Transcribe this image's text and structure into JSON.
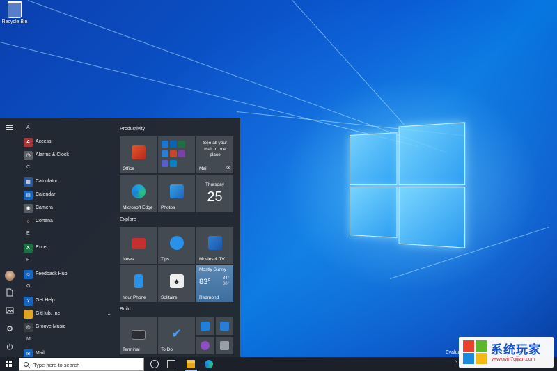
{
  "desktop": {
    "recycle_bin_label": "Recycle Bin",
    "evaluation_text": "Evalua"
  },
  "start_menu": {
    "rail_icons": [
      "hamburger-icon",
      "avatar",
      "document-icon",
      "pictures-icon",
      "gear-icon",
      "power-icon"
    ],
    "app_list": [
      {
        "type": "letter",
        "text": "A"
      },
      {
        "type": "app",
        "name": "Access",
        "icon": "access-icon",
        "color": "#a4373a",
        "glyph": "A"
      },
      {
        "type": "app",
        "name": "Alarms & Clock",
        "icon": "alarm-clock-icon",
        "color": "#5b5f66",
        "glyph": "◷"
      },
      {
        "type": "letter",
        "text": "C"
      },
      {
        "type": "app",
        "name": "Calculator",
        "icon": "calculator-icon",
        "color": "#2b5797",
        "glyph": "▦"
      },
      {
        "type": "app",
        "name": "Calendar",
        "icon": "calendar-icon",
        "color": "#1565c0",
        "glyph": "▤"
      },
      {
        "type": "app",
        "name": "Camera",
        "icon": "camera-icon",
        "color": "#555a60",
        "glyph": "◉"
      },
      {
        "type": "app",
        "name": "Cortana",
        "icon": "cortana-icon",
        "color": "#24282e",
        "glyph": "○"
      },
      {
        "type": "letter",
        "text": "E"
      },
      {
        "type": "app",
        "name": "Excel",
        "icon": "excel-icon",
        "color": "#1d7044",
        "glyph": "X"
      },
      {
        "type": "letter",
        "text": "F"
      },
      {
        "type": "app",
        "name": "Feedback Hub",
        "icon": "feedback-hub-icon",
        "color": "#1565c0",
        "glyph": "☺"
      },
      {
        "type": "letter",
        "text": "G"
      },
      {
        "type": "app",
        "name": "Get Help",
        "icon": "get-help-icon",
        "color": "#1565c0",
        "glyph": "?"
      },
      {
        "type": "app",
        "name": "GitHub, Inc",
        "icon": "folder-icon",
        "color": "#e0a422",
        "glyph": "",
        "expand": "⌄"
      },
      {
        "type": "app",
        "name": "Groove Music",
        "icon": "groove-music-icon",
        "color": "#3a3f45",
        "glyph": "◎"
      },
      {
        "type": "letter",
        "text": "M"
      },
      {
        "type": "app",
        "name": "Mail",
        "icon": "mail-icon",
        "color": "#1565c0",
        "glyph": "✉"
      }
    ],
    "groups": {
      "productivity": "Productivity",
      "explore": "Explore",
      "build": "Build"
    },
    "tiles": {
      "office": "Office",
      "mail_promo": "See all your mail in one place",
      "mail": "Mail",
      "edge": "Microsoft Edge",
      "photos": "Photos",
      "calendar_day": "Thursday",
      "calendar_date": "25",
      "news": "News",
      "tips": "Tips",
      "movies": "Movies & TV",
      "your_phone": "Your Phone",
      "solitaire": "Solitaire",
      "weather_desc": "Mostly Sunny",
      "weather_temp": "83°",
      "weather_high": "84°",
      "weather_low": "60°",
      "weather_city": "Redmond",
      "terminal": "Terminal",
      "todo": "To Do"
    }
  },
  "taskbar": {
    "search_placeholder": "Type here to search",
    "pinned": [
      "cortana-icon",
      "task-view-icon",
      "file-explorer-icon",
      "edge-icon"
    ],
    "tray_caret": "^"
  },
  "watermark": {
    "title": "系统玩家",
    "url": "www.win7qijian.com"
  },
  "colors": {
    "start_bg": "#24282e",
    "tile_bg": "#464c54",
    "taskbar_bg": "#1c2029",
    "accent": "#0a5bd4"
  }
}
